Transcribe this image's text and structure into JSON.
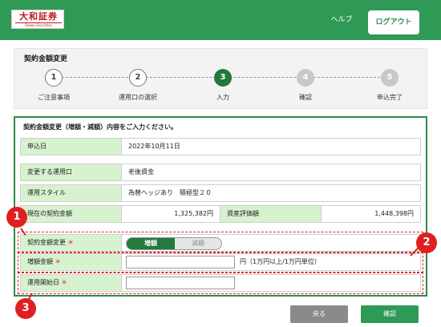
{
  "header": {
    "logo_text": "大和証券",
    "logo_sub": "Daiwa Securities",
    "help_label": "ヘルプ",
    "logout_label": "ログアウト"
  },
  "stepper": {
    "title": "契約金額変更",
    "steps": [
      {
        "number": "1",
        "label": "ご注意事項",
        "state": "done"
      },
      {
        "number": "2",
        "label": "運用口の選択",
        "state": "done"
      },
      {
        "number": "3",
        "label": "入力",
        "state": "current"
      },
      {
        "number": "4",
        "label": "確認",
        "state": "todo"
      },
      {
        "number": "5",
        "label": "申込完了",
        "state": "todo"
      }
    ]
  },
  "form": {
    "intro": "契約金額変更（増額・減額）内容をご入力ください。",
    "application_date_label": "申込日",
    "application_date_value": "2022年10月11日",
    "account_label": "変更する運用口",
    "account_value": "老後資金",
    "style_label": "運用スタイル",
    "style_value": "為替ヘッジあり　積極型２０",
    "current_amount_label": "現在の契約金額",
    "current_amount_value": "1,325,382円",
    "asset_value_label": "資産評価額",
    "asset_value_value": "1,448,398円",
    "change_label": "契約金額変更",
    "required_mark": "＊",
    "toggle_increase": "増額",
    "toggle_decrease": "減額",
    "increase_amount_label": "増額金額",
    "increase_amount_value": "",
    "increase_amount_note": "円（1万円以上/1万円単位）",
    "start_date_label": "運用開始日",
    "start_date_value": ""
  },
  "markers": [
    "1",
    "2",
    "3"
  ],
  "buttons": {
    "back_label": "戻る",
    "confirm_label": "確認"
  },
  "colors": {
    "brand_green": "#2f9a55",
    "label_bg": "#d7f2cf",
    "annotation_red": "#e02020"
  }
}
